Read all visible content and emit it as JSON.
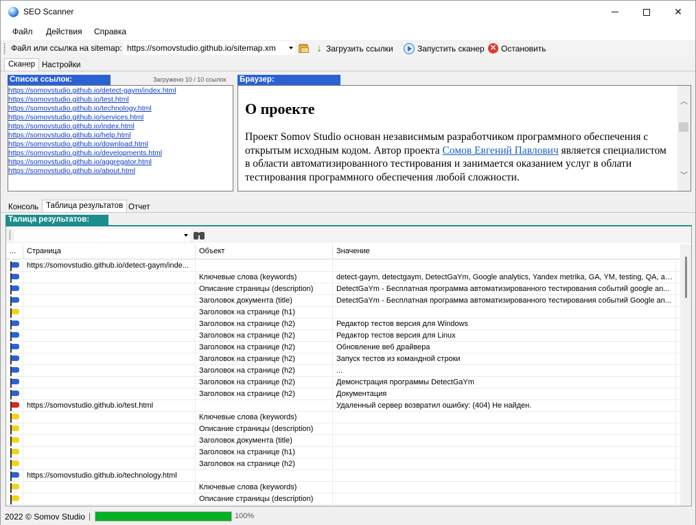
{
  "window": {
    "title": "SEO Scanner"
  },
  "menu": {
    "items": [
      "Файл",
      "Действия",
      "Справка"
    ]
  },
  "toolbar": {
    "sitemap_label": "Файл или ссылка на sitemap:",
    "sitemap_value": "https://somovstudio.github.io/sitemap.xm",
    "load_label": "Загрузить ссылки",
    "start_label": "Запустить сканер",
    "stop_label": "Остановить"
  },
  "top_tabs": {
    "scanner": "Сканер",
    "settings": "Настройки"
  },
  "links_panel": {
    "header": "Список ссылок:",
    "loaded": "Загружено 10 / 10 ссылок",
    "links": [
      "https://somovstudio.github.io/detect-gaym/index.html",
      "https://somovstudio.github.io/test.html",
      "https://somovstudio.github.io/technology.html",
      "https://somovstudio.github.io/services.html",
      "https://somovstudio.github.io/index.html",
      "https://somovstudio.github.io/help.html",
      "https://somovstudio.github.io/download.html",
      "https://somovstudio.github.io/developments.html",
      "https://somovstudio.github.io/aggregator.html",
      "https://somovstudio.github.io/about.html"
    ]
  },
  "browser_panel": {
    "header": "Браузер:",
    "heading": "О проекте",
    "text_before": "Проект Somov Studio основан независимым разработчиком программного обеспечения с открытым исходным кодом. Автор проекта ",
    "author_link": "Сомов Евгений Павлович",
    "text_after": " является специалистом в области автоматизированного тестирования и занимается оказанием услуг в облати тестирования программного обеспечения любой сложности."
  },
  "bottom_tabs": {
    "console": "Консоль",
    "results": "Таблица результатов",
    "report": "Отчет"
  },
  "results": {
    "header": "Талица результатов:",
    "columns": {
      "flag": "...",
      "page": "Страница",
      "object": "Объект",
      "value": "Значение"
    },
    "rows": [
      {
        "flag": "blue",
        "page": "https://somovstudio.github.io/detect-gaym/inde...",
        "object": "",
        "value": ""
      },
      {
        "flag": "blue",
        "page": "",
        "object": "Ключевые слова (keywords)",
        "value": "detect-gaym, detectgaym, DetectGaYm, Google analytics, Yandex metrika, GA, YM, testing, QA, авто..."
      },
      {
        "flag": "blue",
        "page": "",
        "object": "Описание страницы (description)",
        "value": "DetectGaYm - Бесплатная программа автоматизированного тестирования событий google an..."
      },
      {
        "flag": "blue",
        "page": "",
        "object": "Заголовок документа (title)",
        "value": "DetectGaYm - Бесплатная программа автоматизированного тестирования событий Google an..."
      },
      {
        "flag": "yellow",
        "page": "",
        "object": "Заголовок на странице (h1)",
        "value": ""
      },
      {
        "flag": "blue",
        "page": "",
        "object": "Заголовок на странице (h2)",
        "value": "Редактор тестов версия для Windows"
      },
      {
        "flag": "blue",
        "page": "",
        "object": "Заголовок на странице (h2)",
        "value": "Редактор тестов версия для Linux"
      },
      {
        "flag": "blue",
        "page": "",
        "object": "Заголовок на странице (h2)",
        "value": "Обновление веб драйвера"
      },
      {
        "flag": "blue",
        "page": "",
        "object": "Заголовок на странице (h2)",
        "value": "Запуск тестов из командной строки"
      },
      {
        "flag": "blue",
        "page": "",
        "object": "Заголовок на странице (h2)",
        "value": "..."
      },
      {
        "flag": "blue",
        "page": "",
        "object": "Заголовок на странице (h2)",
        "value": "Демонстрация программы DetectGaYm"
      },
      {
        "flag": "blue",
        "page": "",
        "object": "Заголовок на странице (h2)",
        "value": "Документация"
      },
      {
        "flag": "red",
        "page": "https://somovstudio.github.io/test.html",
        "object": "",
        "value": "Удаленный сервер возвратил ошибку: (404) Не найден."
      },
      {
        "flag": "yellow",
        "page": "",
        "object": "Ключевые слова (keywords)",
        "value": ""
      },
      {
        "flag": "yellow",
        "page": "",
        "object": "Описание страницы (description)",
        "value": ""
      },
      {
        "flag": "yellow",
        "page": "",
        "object": "Заголовок документа (title)",
        "value": ""
      },
      {
        "flag": "yellow",
        "page": "",
        "object": "Заголовок на странице (h1)",
        "value": ""
      },
      {
        "flag": "yellow",
        "page": "",
        "object": "Заголовок на странице (h2)",
        "value": ""
      },
      {
        "flag": "blue",
        "page": "https://somovstudio.github.io/technology.html",
        "object": "",
        "value": ""
      },
      {
        "flag": "yellow",
        "page": "",
        "object": "Ключевые слова (keywords)",
        "value": ""
      },
      {
        "flag": "yellow",
        "page": "",
        "object": "Описание страницы (description)",
        "value": ""
      }
    ]
  },
  "flag_colors": {
    "blue": "#2b62d9",
    "yellow": "#f2d21b",
    "red": "#e0261c"
  },
  "status": {
    "copyright": "2022 © Somov Studio",
    "separator": "|",
    "progress_percent": 100,
    "progress_label": "100%"
  }
}
